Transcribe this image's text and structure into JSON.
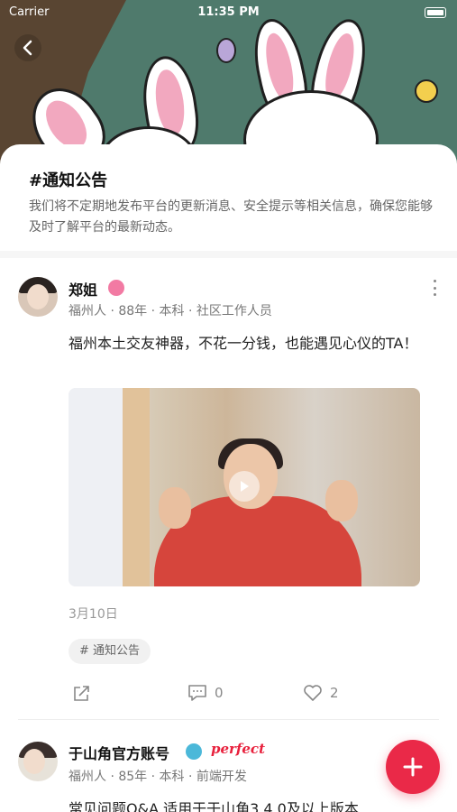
{
  "status_bar": {
    "carrier": "Carrier",
    "time": "11:35 PM"
  },
  "topic": {
    "title": "#通知公告",
    "description": "我们将不定期地发布平台的更新消息、安全提示等相关信息，确保您能够及时了解平台的最新动态。"
  },
  "posts": [
    {
      "user_name": "郑姐",
      "meta": "福州人 · 88年 · 本科 · 社区工作人员",
      "text": "福州本土交友神器，不花一分钱，也能遇见心仪的TA！",
      "date": "3月10日",
      "tag": "# 通知公告",
      "comments": "0",
      "likes": "2"
    },
    {
      "user_name": "于山角官方账号",
      "badge_text": "perfect",
      "meta": "福州人 · 85年 · 本科 · 前端开发",
      "text": "常见问题Q&A  适用于于山角3.4.0及以上版本"
    }
  ],
  "icons": {
    "back": "chevron-left-icon",
    "more": "more-vertical-icon",
    "play": "play-icon",
    "share": "share-icon",
    "comment": "comment-icon",
    "like": "heart-icon",
    "add": "plus-icon"
  },
  "colors": {
    "accent": "#ea2948",
    "hero": "#4f7a6c"
  }
}
